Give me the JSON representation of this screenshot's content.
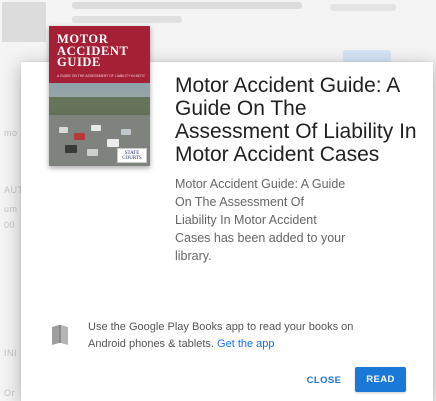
{
  "background": {
    "side_fragments": [
      "mo",
      "AUT",
      "um",
      "00",
      "INI",
      "Or"
    ]
  },
  "book": {
    "cover_title_lines": [
      "MOTOR",
      "ACCIDENT",
      "GUIDE"
    ],
    "cover_subtitle": "A GUIDE ON THE ASSESSMENT OF LIABILITY IN MOTOR ACCIDENT CASES",
    "cover_publisher": "STATE COURTS"
  },
  "dialog": {
    "title": "Motor Accident Guide: A Guide On The Assessment Of Liability In Motor Accident Cases",
    "message": "Motor Accident Guide: A Guide On The Assessment Of Liability In Motor Accident Cases has been added to your library.",
    "info_text": "Use the Google Play Books app to read your books on Android phones & tablets.",
    "info_link": "Get the app",
    "close_label": "CLOSE",
    "read_label": "READ",
    "icon": "book-icon",
    "accent_color": "#1a79d6",
    "cover_color": "#a51f35"
  }
}
